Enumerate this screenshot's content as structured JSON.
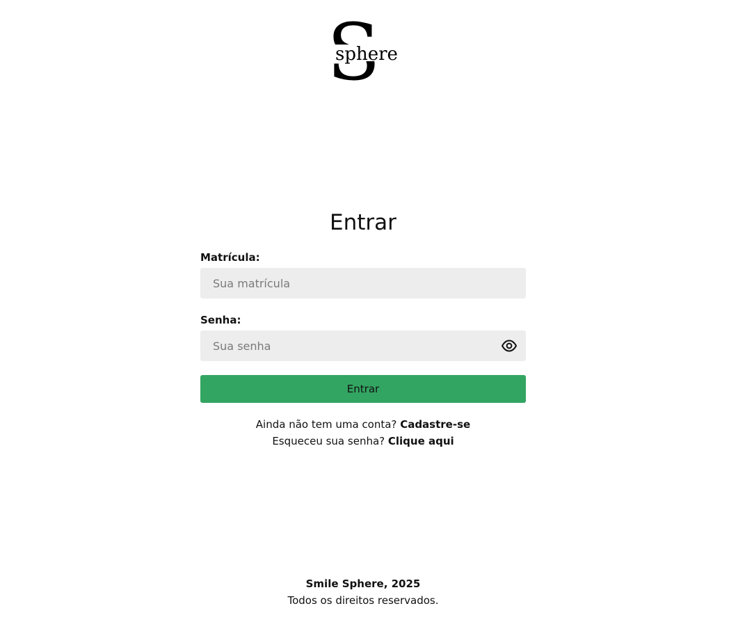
{
  "logo": {
    "big_letter": "S",
    "word": "sphere"
  },
  "login": {
    "title": "Entrar",
    "matricula_label": "Matrícula:",
    "matricula_placeholder": "Sua matrícula",
    "senha_label": "Senha:",
    "senha_placeholder": "Sua senha",
    "show_password_icon": "eye-icon",
    "submit_label": "Entrar"
  },
  "links": {
    "signup_prompt": "Ainda não tem uma conta?",
    "signup_link": "Cadastre-se",
    "forgot_prompt": "Esqueceu sua senha?",
    "forgot_link": "Clique aqui"
  },
  "footer": {
    "copyright": "Smile Sphere, 2025",
    "rights": "Todos os direitos reservados."
  },
  "colors": {
    "primary_button": "#33a562",
    "input_background": "#ededed",
    "text": "#111111"
  }
}
